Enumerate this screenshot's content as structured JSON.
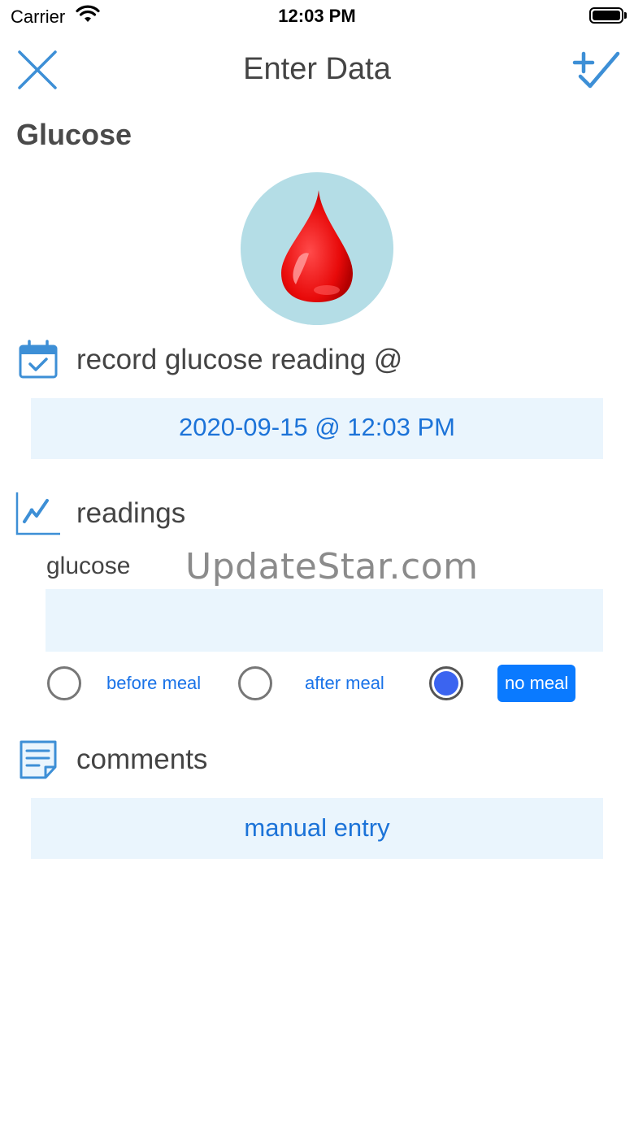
{
  "status_bar": {
    "carrier": "Carrier",
    "time": "12:03 PM",
    "icons": [
      "wifi-icon",
      "battery-icon"
    ]
  },
  "nav": {
    "title": "Enter Data",
    "close_icon": "close-icon",
    "save_icon": "add-check-icon",
    "accent_color": "#3d8fd6"
  },
  "section": {
    "title": "Glucose",
    "image": "blood-drop-icon"
  },
  "record": {
    "icon": "calendar-check-icon",
    "label": "record glucose reading @",
    "datetime": "2020-09-15 @ 12:03 PM"
  },
  "readings": {
    "icon": "line-chart-icon",
    "label": "readings",
    "field_label": "glucose",
    "field_value": "",
    "watermark": "UpdateStar.com",
    "meal_options": [
      {
        "label": "before meal",
        "selected": false
      },
      {
        "label": "after meal",
        "selected": false
      },
      {
        "label": "no meal",
        "selected": true
      }
    ]
  },
  "comments": {
    "icon": "notes-icon",
    "label": "comments",
    "value": "manual entry"
  },
  "colors": {
    "field_background": "#eaf5fd",
    "link_blue": "#1a73e8",
    "selected_blue": "#0a7aff",
    "radio_fill": "#3b64f0"
  }
}
